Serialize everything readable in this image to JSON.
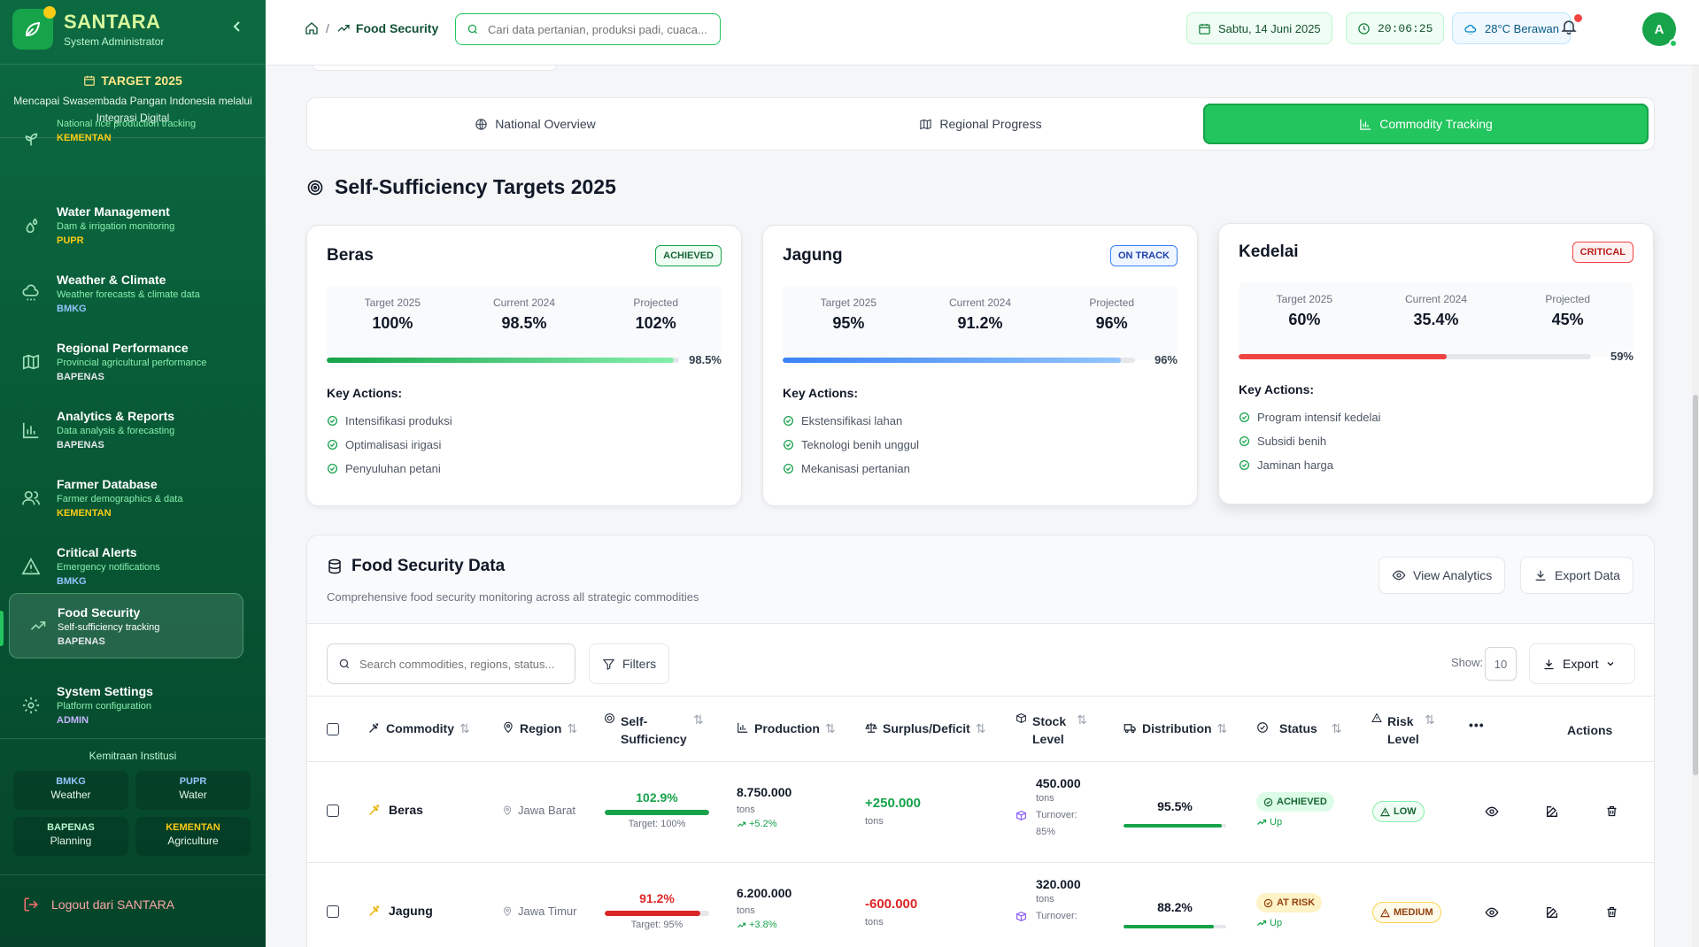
{
  "app": {
    "name": "SANTARA",
    "role": "System Administrator"
  },
  "target": {
    "title": "TARGET 2025",
    "desc": "Mencapai Swasembada Pangan Indonesia melalui Integrasi Digital"
  },
  "sidebar": {
    "items": [
      {
        "label": "",
        "sub": "National rice production tracking",
        "org": "KEMENTAN",
        "org_color": "#facc15",
        "icon": "sprout-icon"
      },
      {
        "label": "Water Management",
        "sub": "Dam & irrigation monitoring",
        "org": "PUPR",
        "org_color": "#facc15",
        "icon": "droplets-icon"
      },
      {
        "label": "Weather & Climate",
        "sub": "Weather forecasts & climate data",
        "org": "BMKG",
        "org_color": "#93c5fd",
        "icon": "cloud-rain-icon"
      },
      {
        "label": "Regional Performance",
        "sub": "Provincial agricultural performance",
        "org": "BAPENAS",
        "org_color": "#e5e7eb",
        "icon": "map-icon"
      },
      {
        "label": "Analytics & Reports",
        "sub": "Data analysis & forecasting",
        "org": "BAPENAS",
        "org_color": "#e5e7eb",
        "icon": "bar-chart-icon"
      },
      {
        "label": "Farmer Database",
        "sub": "Farmer demographics & data",
        "org": "KEMENTAN",
        "org_color": "#facc15",
        "icon": "users-icon"
      },
      {
        "label": "Critical Alerts",
        "sub": "Emergency notifications",
        "org": "BMKG",
        "org_color": "#93c5fd",
        "icon": "alert-triangle-icon"
      },
      {
        "label": "Food Security",
        "sub": "Self-sufficiency tracking",
        "org": "BAPENAS",
        "org_color": "#e5e7eb",
        "icon": "trending-up-icon"
      },
      {
        "label": "System Settings",
        "sub": "Platform configuration",
        "org": "ADMIN",
        "org_color": "#c4b5fd",
        "icon": "gear-icon"
      }
    ],
    "active": "Food Security"
  },
  "partners": {
    "title": "Kemitraan Institusi",
    "items": [
      {
        "org": "BMKG",
        "name": "Weather",
        "color": "#93c5fd"
      },
      {
        "org": "PUPR",
        "name": "Water",
        "color": "#93c5fd"
      },
      {
        "org": "BAPENAS",
        "name": "Planning",
        "color": "#bbf7d0"
      },
      {
        "org": "KEMENTAN",
        "name": "Agriculture",
        "color": "#facc15"
      }
    ]
  },
  "logout": "Logout dari SANTARA",
  "header": {
    "breadcrumb_sep": "/",
    "breadcrumb_current": "Food Security",
    "search_placeholder": "Cari data pertanian, produksi padi, cuaca...",
    "date": "Sabtu, 14 Juni 2025",
    "time": "20:06:25",
    "weather": "28°C Berawan",
    "avatar": "A"
  },
  "tabs": [
    {
      "label": "National Overview",
      "icon": "globe-icon"
    },
    {
      "label": "Regional Progress",
      "icon": "map-icon"
    },
    {
      "label": "Commodity Tracking",
      "icon": "bar-chart-icon",
      "active": true
    }
  ],
  "targets_title": "Self-Sufficiency Targets 2025",
  "target_cards": [
    {
      "name": "Beras",
      "badge": "ACHIEVED",
      "target_label": "Target 2025",
      "target": "100%",
      "current_label": "Current 2024",
      "current": "98.5%",
      "projected_label": "Projected",
      "projected": "102%",
      "progress": 98.5,
      "progress_text": "98.5%",
      "color": "#16a34a",
      "key_actions_label": "Key Actions:",
      "actions": [
        "Intensifikasi produksi",
        "Optimalisasi irigasi",
        "Penyuluhan petani"
      ]
    },
    {
      "name": "Jagung",
      "badge": "ON TRACK",
      "target_label": "Target 2025",
      "target": "95%",
      "current_label": "Current 2024",
      "current": "91.2%",
      "projected_label": "Projected",
      "projected": "96%",
      "progress": 96,
      "progress_text": "96%",
      "color": "#3b82f6",
      "key_actions_label": "Key Actions:",
      "actions": [
        "Ekstensifikasi lahan",
        "Teknologi benih unggul",
        "Mekanisasi pertanian"
      ]
    },
    {
      "name": "Kedelai",
      "badge": "CRITICAL",
      "target_label": "Target 2025",
      "target": "60%",
      "current_label": "Current 2024",
      "current": "35.4%",
      "projected_label": "Projected",
      "projected": "45%",
      "progress": 59,
      "progress_text": "59%",
      "color": "#ef4444",
      "key_actions_label": "Key Actions:",
      "actions": [
        "Program intensif kedelai",
        "Subsidi benih",
        "Jaminan harga"
      ]
    }
  ],
  "fsd": {
    "title": "Food Security Data",
    "subtitle": "Comprehensive food security monitoring across all strategic commodities",
    "view_analytics": "View Analytics",
    "export_data": "Export Data",
    "search_placeholder": "Search commodities, regions, status...",
    "filters": "Filters",
    "show_label": "Show:",
    "show_value": "10",
    "export": "Export",
    "columns": {
      "commodity": "Commodity",
      "region": "Region",
      "self_sufficiency": "Self-Sufficiency",
      "production": "Production",
      "surplus": "Surplus/Deficit",
      "stock": "Stock Level",
      "distribution": "Distribution",
      "status": "Status",
      "risk": "Risk Level",
      "more": "•••",
      "actions": "Actions"
    },
    "rows": [
      {
        "commodity": "Beras",
        "region": "Jawa Barat",
        "ss": "102.9%",
        "ss_value": 102.9,
        "ss_color": "#16a34a",
        "ss_target": "Target: 100%",
        "production": "8.750.000",
        "prod_unit": "tons",
        "prod_growth": "+5.2%",
        "surplus": "+250.000",
        "surplus_color": "#16a34a",
        "surplus_unit": "tons",
        "stock": "450.000",
        "stock_unit": "tons",
        "turnover_label": "Turnover:",
        "turnover": "85%",
        "distribution": "95.5%",
        "dist_value": 95.5,
        "status": "ACHIEVED",
        "status_bg": "#dcfce7",
        "status_fg": "#166534",
        "trend": "Up",
        "risk": "LOW",
        "risk_bg": "#f0fdf4",
        "risk_fg": "#166534",
        "risk_border": "#86efac"
      },
      {
        "commodity": "Jagung",
        "region": "Jawa Timur",
        "ss": "91.2%",
        "ss_value": 91.2,
        "ss_color": "#dc2626",
        "ss_target": "Target: 95%",
        "production": "6.200.000",
        "prod_unit": "tons",
        "prod_growth": "+3.8%",
        "surplus": "-600.000",
        "surplus_color": "#dc2626",
        "surplus_unit": "tons",
        "stock": "320.000",
        "stock_unit": "tons",
        "turnover_label": "Turnover:",
        "turnover": "",
        "distribution": "88.2%",
        "dist_value": 88.2,
        "status": "AT RISK",
        "status_bg": "#fef3c7",
        "status_fg": "#92400e",
        "trend": "Up",
        "risk": "MEDIUM",
        "risk_bg": "#fffbeb",
        "risk_fg": "#92400e",
        "risk_border": "#fcd34d"
      }
    ]
  }
}
